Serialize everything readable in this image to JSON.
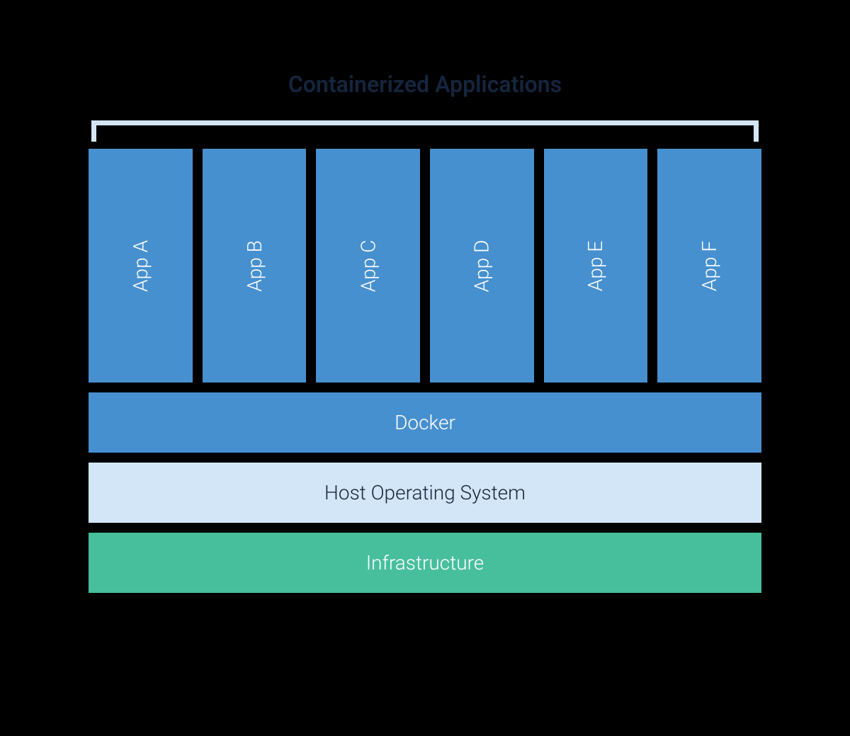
{
  "title": "Containerized Applications",
  "apps": {
    "0": "App A",
    "1": "App B",
    "2": "App C",
    "3": "App D",
    "4": "App E",
    "5": "App F"
  },
  "layers": {
    "docker": "Docker",
    "os": "Host Operating System",
    "infra": "Infrastructure"
  },
  "colors": {
    "app_box": "#4790cf",
    "docker_layer": "#4790cf",
    "os_layer": "#d3e6f7",
    "infra_layer": "#47bf9c",
    "title_text": "#14253d"
  }
}
